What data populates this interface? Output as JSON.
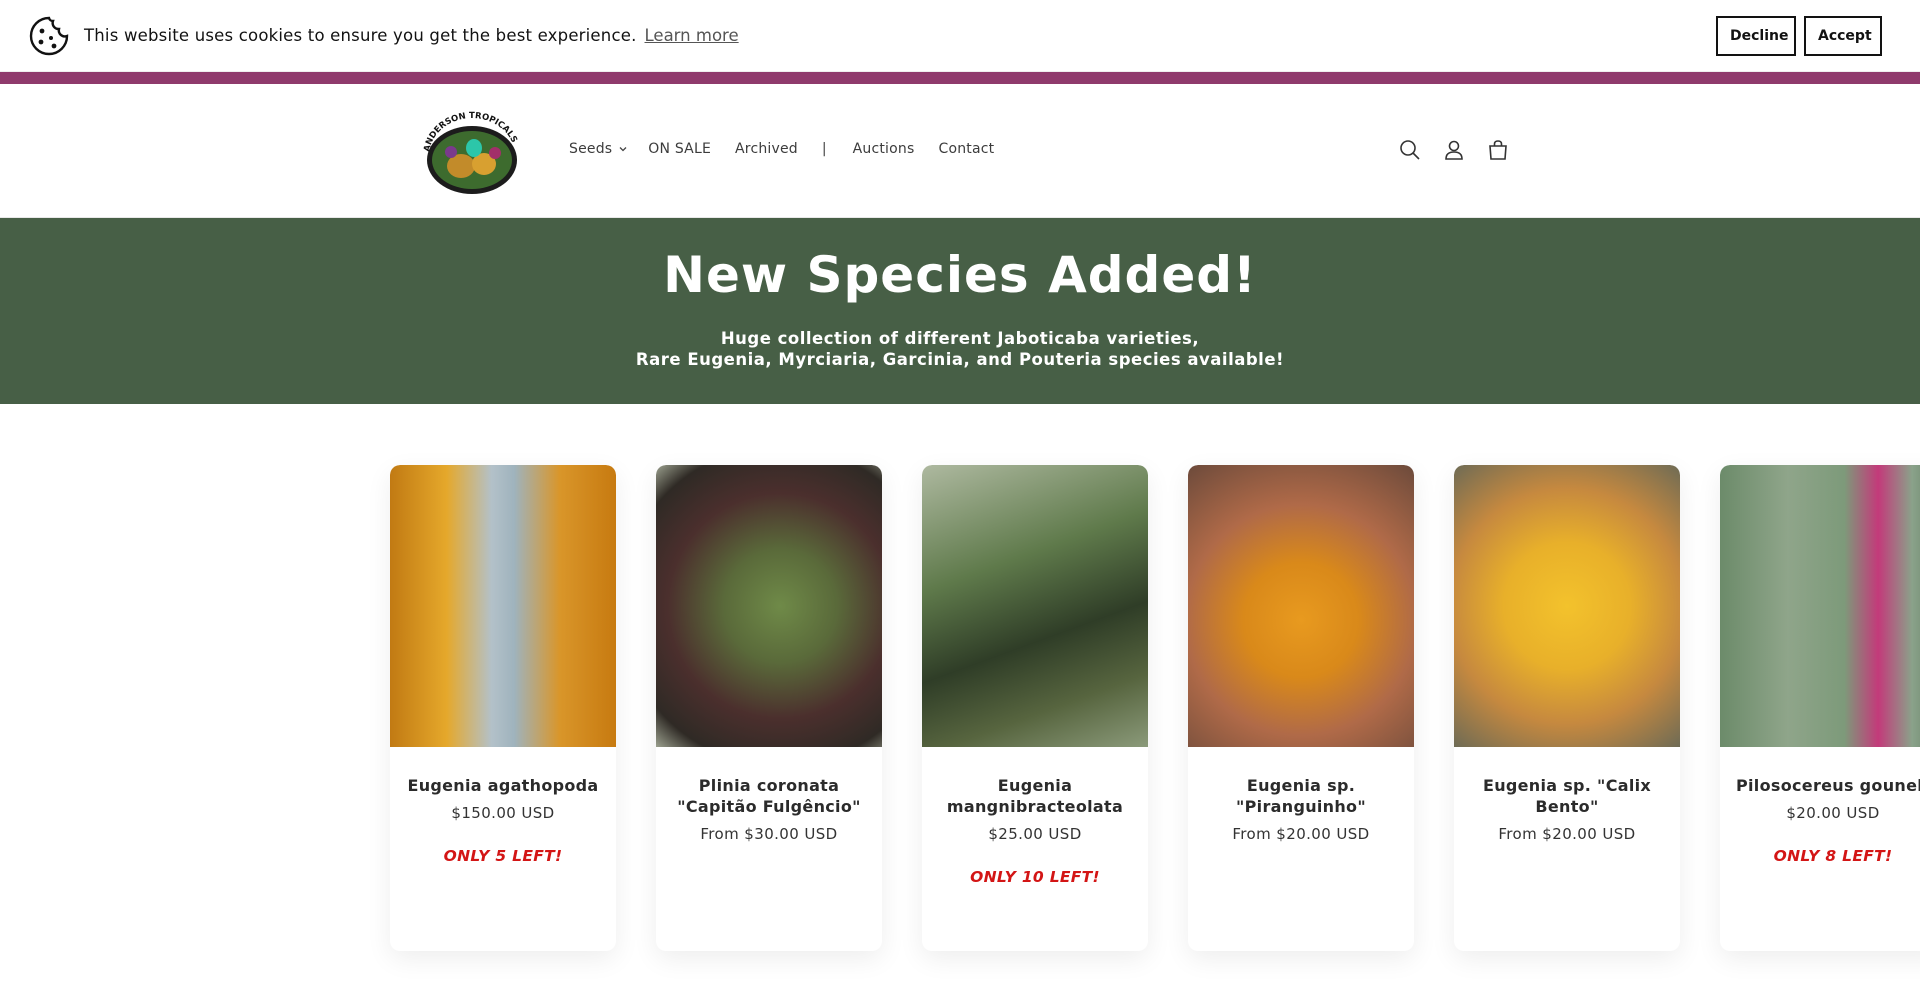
{
  "cookie_bar": {
    "message": "This website uses cookies to ensure you get the best experience.",
    "learn_more": "Learn more",
    "decline_label": "Decline",
    "accept_label": "Accept"
  },
  "header": {
    "logo_alt": "ANDERSON TROPICALS",
    "nav": {
      "seeds": "Seeds",
      "on_sale": "ON SALE",
      "archived": "Archived",
      "separator": "|",
      "auctions": "Auctions",
      "contact": "Contact"
    },
    "icons": [
      "search-icon",
      "account-icon",
      "cart-icon"
    ]
  },
  "banner": {
    "title": "New Species Added!",
    "line1": "Huge collection of different Jaboticaba varieties,",
    "line2": "Rare Eugenia, Myrciaria, Garcinia, and Pouteria species available!"
  },
  "products": [
    {
      "title": "Eugenia agathopoda",
      "price": "$150.00 USD",
      "stock": "ONLY 5 LEFT!"
    },
    {
      "title": "Plinia coronata \"Capitão Fulgêncio\"",
      "price": "From $30.00 USD",
      "stock": ""
    },
    {
      "title": "Eugenia mangnibracteolata",
      "price": "$25.00 USD",
      "stock": "ONLY 10 LEFT!"
    },
    {
      "title": "Eugenia sp. \"Piranguinho\"",
      "price": "From $20.00 USD",
      "stock": ""
    },
    {
      "title": "Eugenia sp. \"Calix Bento\"",
      "price": "From $20.00 USD",
      "stock": ""
    },
    {
      "title": "Pilosocereus gounellii",
      "price": "$20.00 USD",
      "stock": "ONLY 8 LEFT!"
    }
  ],
  "colors": {
    "announcement_stripe": "#8f3a6c",
    "banner_bg": "#475f46",
    "stock_red": "#d31515"
  }
}
